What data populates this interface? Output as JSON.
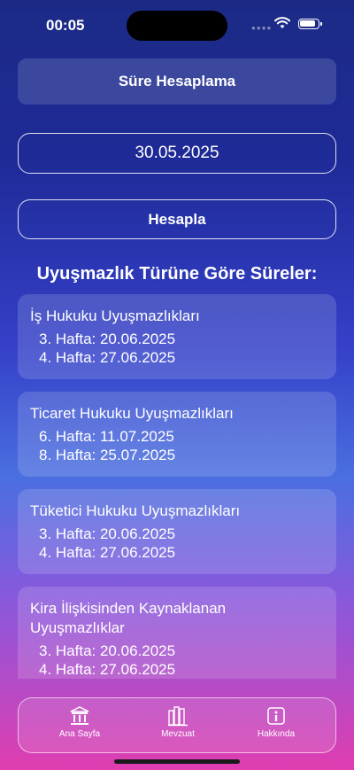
{
  "status": {
    "time": "00:05"
  },
  "header": {
    "title": "Süre Hesaplama"
  },
  "form": {
    "date_value": "30.05.2025",
    "calculate_label": "Hesapla"
  },
  "section": {
    "title": "Uyuşmazlık Türüne Göre Süreler:"
  },
  "cards": [
    {
      "title": "İş Hukuku Uyuşmazlıkları",
      "lines": [
        "3. Hafta: 20.06.2025",
        "4. Hafta: 27.06.2025"
      ]
    },
    {
      "title": "Ticaret Hukuku Uyuşmazlıkları",
      "lines": [
        "6. Hafta: 11.07.2025",
        "8. Hafta: 25.07.2025"
      ]
    },
    {
      "title": "Tüketici Hukuku Uyuşmazlıkları",
      "lines": [
        "3. Hafta: 20.06.2025",
        "4. Hafta: 27.06.2025"
      ]
    },
    {
      "title": "Kira İlişkisinden Kaynaklanan Uyuşmazlıklar",
      "lines": [
        "3. Hafta: 20.06.2025",
        "4. Hafta: 27.06.2025"
      ]
    }
  ],
  "tabbar": {
    "items": [
      {
        "label": "Ana Sayfa",
        "icon": "courthouse-icon"
      },
      {
        "label": "Mevzuat",
        "icon": "books-icon"
      },
      {
        "label": "Hakkında",
        "icon": "info-icon"
      }
    ]
  }
}
